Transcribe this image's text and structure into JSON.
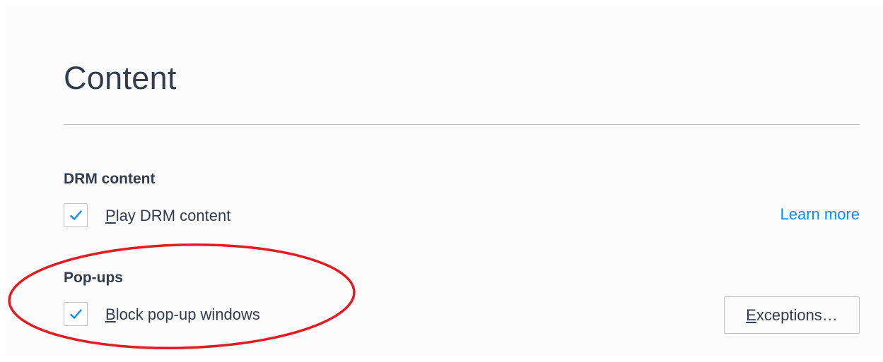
{
  "page": {
    "title": "Content"
  },
  "drm": {
    "heading": "DRM content",
    "checkbox": {
      "checked": true,
      "label_mnemonic": "P",
      "label_rest": "lay DRM content"
    },
    "learn_more": "Learn more"
  },
  "popups": {
    "heading": "Pop-ups",
    "checkbox": {
      "checked": true,
      "label_mnemonic": "B",
      "label_rest": "lock pop-up windows"
    },
    "exceptions_button": {
      "label_mnemonic": "E",
      "label_rest": "xceptions…"
    }
  },
  "icons": {
    "checkbox_check": "checkmark-icon"
  },
  "colors": {
    "accent": "#0a8dff",
    "text": "#333c4e",
    "annotation": "#e31b23",
    "divider": "#c1c1c1",
    "pane_background": "#fbfbfb"
  }
}
